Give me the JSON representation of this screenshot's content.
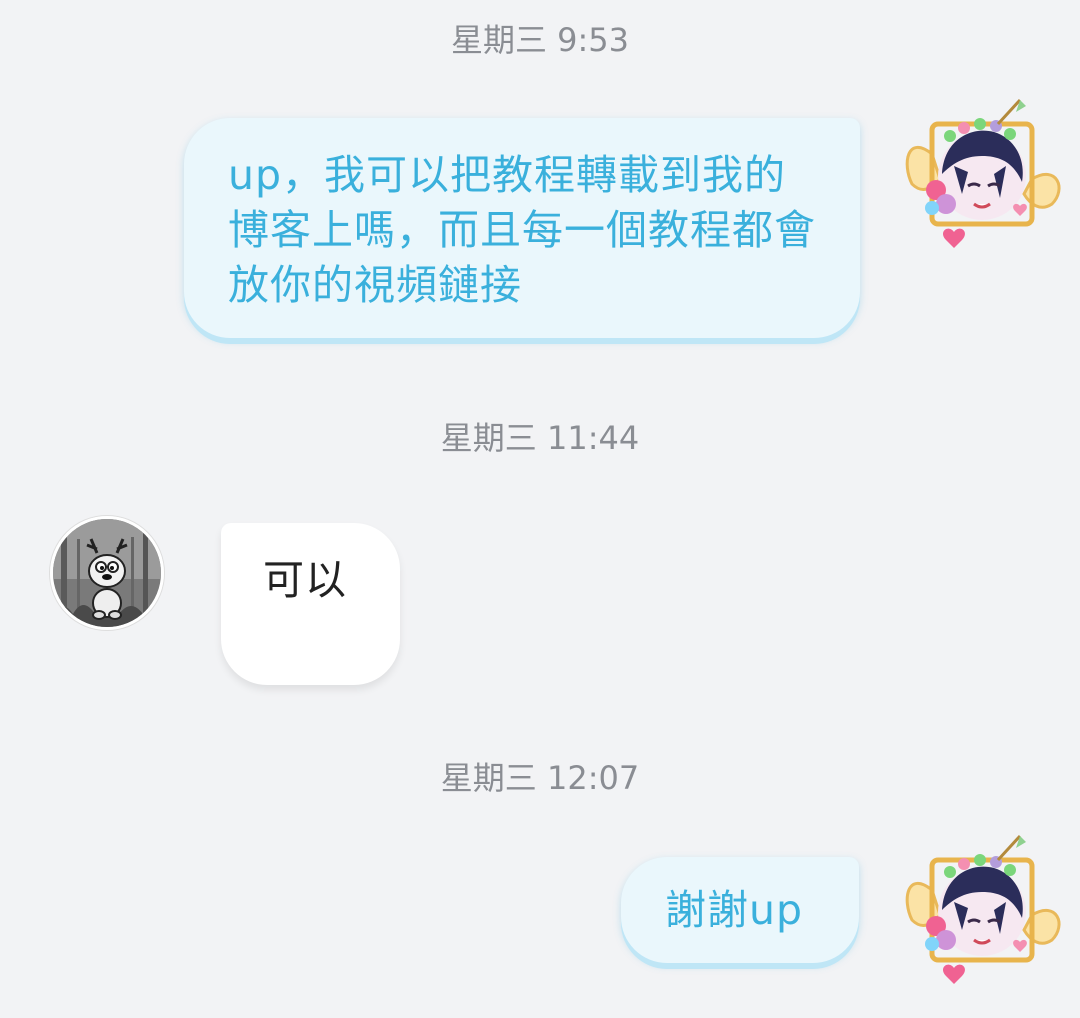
{
  "chat": {
    "messages": [
      {
        "timestamp": "星期三 9:53",
        "sender": "me",
        "text": "up，我可以把教程轉載到我的博客上嗎，而且每一個教程都會放你的視頻鏈接"
      },
      {
        "timestamp": "星期三 11:44",
        "sender": "other",
        "text": "可以"
      },
      {
        "timestamp": "星期三 12:07",
        "sender": "me",
        "text": "謝謝up"
      }
    ]
  },
  "colors": {
    "background": "#f2f3f5",
    "sent_bubble": "#eaf7fc",
    "sent_text": "#3ab0dc",
    "received_bubble": "#ffffff",
    "received_text": "#222222",
    "timestamp": "#8a8d93"
  },
  "icons": {
    "my_avatar": "anime-character-avatar-icon",
    "other_avatar": "cartoon-deer-avatar-icon"
  }
}
